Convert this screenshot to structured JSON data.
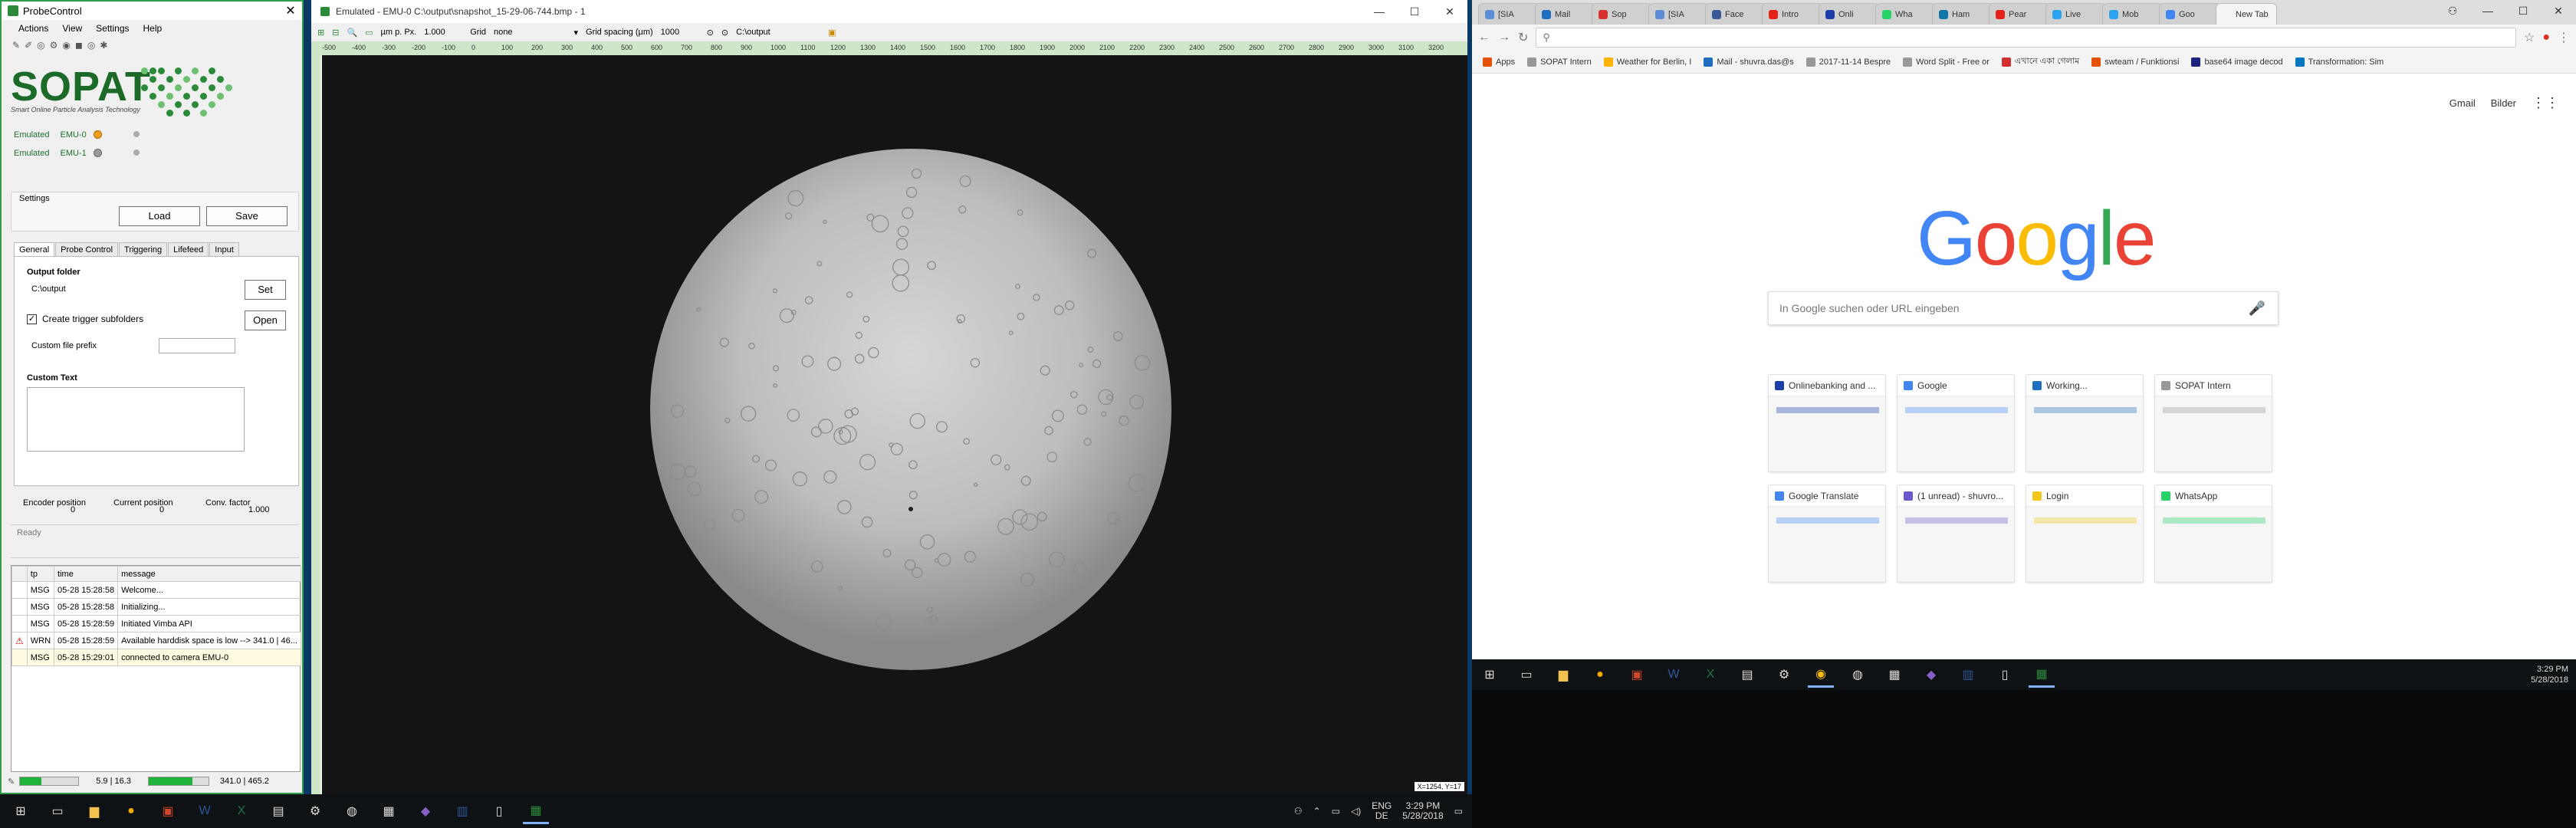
{
  "probe": {
    "title": "ProbeControl",
    "menu": [
      "Actions",
      "View",
      "Settings",
      "Help"
    ],
    "logo_text": "SOPAT",
    "logo_sub": "Smart Online Particle Analysis Technology",
    "devices": [
      {
        "name": "Emulated",
        "id": "EMU-0",
        "led": "#f0a020"
      },
      {
        "name": "Emulated",
        "id": "EMU-1",
        "led": "#999999"
      }
    ],
    "settings_label": "Settings",
    "load_label": "Load",
    "save_label": "Save",
    "tabs": [
      "General",
      "Probe Control",
      "Triggering",
      "Lifefeed",
      "Input"
    ],
    "output_folder_label": "Output folder",
    "output_folder_value": "C:\\output",
    "set_label": "Set",
    "open_label": "Open",
    "trigger_subfolders_label": "Create trigger subfolders",
    "custom_prefix_label": "Custom file prefix",
    "custom_text_label": "Custom Text",
    "encoder_label": "Encoder position",
    "encoder_value": "0",
    "current_label": "Current position",
    "current_value": "0",
    "conv_label": "Conv. factor",
    "conv_value": "1.000",
    "status_text": "Ready",
    "log_headers": [
      "tp",
      "time",
      "message"
    ],
    "log_rows": [
      {
        "tp": "MSG",
        "time": "05-28 15:28:58",
        "message": "Welcome..."
      },
      {
        "tp": "MSG",
        "time": "05-28 15:28:58",
        "message": "Initializing..."
      },
      {
        "tp": "MSG",
        "time": "05-28 15:28:59",
        "message": "Initiated Vimba API"
      },
      {
        "tp": "WRN",
        "time": "05-28 15:28:59",
        "message": "Available harddisk space is low --> 341.0 | 46..."
      },
      {
        "tp": "MSG",
        "time": "05-28 15:29:01",
        "message": "connected to camera EMU-0"
      }
    ],
    "stat_left": "5.9 | 16.3",
    "stat_right": "341.0 | 465.2",
    "progress_left": 0.36,
    "progress_right": 0.73
  },
  "emu": {
    "title": "Emulated - EMU-0 C:\\output\\snapshot_15-29-06-744.bmp - 1",
    "unit_label": "µm p. Px.",
    "unit_value": "1.000",
    "grid_label": "Grid",
    "grid_value": "none",
    "grid_spacing_label": "Grid spacing (µm)",
    "grid_spacing_value": "1000",
    "path_value": "C:\\output",
    "ruler_ticks": [
      "-500",
      "-400",
      "-300",
      "-200",
      "-100",
      "0",
      "100",
      "200",
      "300",
      "400",
      "500",
      "600",
      "700",
      "800",
      "900",
      "1000",
      "1100",
      "1200",
      "1300",
      "1400",
      "1500",
      "1600",
      "1700",
      "1800",
      "1900",
      "2000",
      "2100",
      "2200",
      "2300",
      "2400",
      "2500",
      "2600",
      "2700",
      "2800",
      "2900",
      "3000",
      "3100",
      "3200"
    ],
    "pixel_info": "X=1254, Y=17"
  },
  "taskbar": {
    "icons": [
      "windows-icon",
      "task-view-icon",
      "file-explorer-icon",
      "outlook-icon",
      "word-icon",
      "excel-icon",
      "cmd-icon",
      "settings-icon",
      "chrome-icon",
      "rdp-icon",
      "calculator-icon",
      "visual-studio-icon",
      "powerpoint-like-icon",
      "notepad-icon",
      "probecontrol-icon"
    ],
    "lang": "ENG",
    "lang2": "DE",
    "time": "3:29 PM",
    "date": "5/28/2018"
  },
  "chrome": {
    "tabs": [
      {
        "label": "[SIA",
        "color": "#5b8ed6"
      },
      {
        "label": "Mail",
        "color": "#1e6fc0"
      },
      {
        "label": "Sop",
        "color": "#d9302c"
      },
      {
        "label": "[SIA",
        "color": "#5b8ed6"
      },
      {
        "label": "Face",
        "color": "#3b5998"
      },
      {
        "label": "Intro",
        "color": "#e62117"
      },
      {
        "label": "Onli",
        "color": "#1a3fa8"
      },
      {
        "label": "Wha",
        "color": "#25d366"
      },
      {
        "label": "Ham",
        "color": "#0e76a8"
      },
      {
        "label": "Pear",
        "color": "#e62117"
      },
      {
        "label": "Live",
        "color": "#2aa3f0"
      },
      {
        "label": "Mob",
        "color": "#2aa3f0"
      },
      {
        "label": "Goo",
        "color": "#4285f4"
      },
      {
        "label": "New Tab",
        "color": "#f4f4f4"
      }
    ],
    "bookmarks": [
      {
        "label": "Apps",
        "color": "#e65100"
      },
      {
        "label": "SOPAT Intern",
        "color": "#999"
      },
      {
        "label": "Weather for Berlin, I",
        "color": "#ffb300"
      },
      {
        "label": "Mail - shuvra.das@s",
        "color": "#1e6fc0"
      },
      {
        "label": "2017-11-14 Bespre",
        "color": "#999"
      },
      {
        "label": "Word Split - Free or",
        "color": "#999"
      },
      {
        "label": "এখানে একা গেলাম",
        "color": "#d32f2f"
      },
      {
        "label": "swteam / Funktionsi",
        "color": "#e65100"
      },
      {
        "label": "base64 image decod",
        "color": "#1a237e"
      },
      {
        "label": "Transformation: Sim",
        "color": "#0277bd"
      }
    ],
    "gmail": "Gmail",
    "bilder": "Bilder",
    "google_logo": [
      "G",
      "o",
      "o",
      "g",
      "l",
      "e"
    ],
    "google_colors": [
      "#4285f4",
      "#ea4335",
      "#fbbc05",
      "#4285f4",
      "#34a853",
      "#ea4335"
    ],
    "search_placeholder": "In Google suchen oder URL eingeben",
    "tiles": [
      {
        "title": "Onlinebanking and ...",
        "color": "#1a3fa8"
      },
      {
        "title": "Google",
        "color": "#4285f4"
      },
      {
        "title": "Working...",
        "color": "#1e6fc0"
      },
      {
        "title": "SOPAT Intern",
        "color": "#999"
      },
      {
        "title": "Google Translate",
        "color": "#4285f4"
      },
      {
        "title": "(1 unread) - shuvro...",
        "color": "#6a5acd"
      },
      {
        "title": "Login",
        "color": "#f5c518"
      },
      {
        "title": "WhatsApp",
        "color": "#25d366"
      }
    ]
  },
  "taskbar2": {
    "time": "3:29 PM",
    "date": "5/28/2018"
  }
}
